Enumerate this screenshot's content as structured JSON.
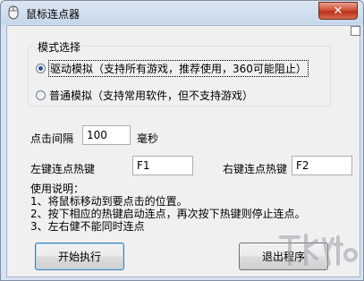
{
  "window": {
    "title": "鼠标连点器",
    "close_symbol": "✕"
  },
  "mode_group": {
    "label": "模式选择",
    "options": [
      {
        "label": "驱动模拟（支持所有游戏，推荐使用，360可能阻止）",
        "selected": true
      },
      {
        "label": "普通模拟（支持常用软件，但不支持游戏）",
        "selected": false
      }
    ]
  },
  "interval": {
    "label": "点击间隔",
    "value": "100",
    "unit": "毫秒"
  },
  "hotkeys": {
    "left_label": "左键连点热键",
    "left_value": "F1",
    "right_label": "右键连点热键",
    "right_value": "F2"
  },
  "instructions": {
    "title": "使用说明：",
    "lines": [
      "1、将鼠标移动到要点击的位置。",
      "2、按下相应的热键启动连点，再次按下热键则停止连点。",
      "3、左右健不能同时连点"
    ]
  },
  "buttons": {
    "start": "开始执行",
    "exit": "退出程序"
  },
  "colors": {
    "title_bar": "#c7d7ea",
    "client_bg": "#f0f0f0",
    "close_button": "#c9452c"
  },
  "icons": {
    "app": "mouse-icon",
    "close": "close-icon"
  }
}
